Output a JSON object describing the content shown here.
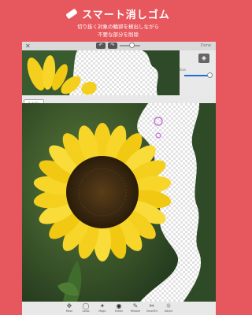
{
  "promo": {
    "title": "スマート消しゴム",
    "subtitle_line1": "切り抜く対象の輪郭を検出しながら",
    "subtitle_line2": "不要な部分を削除"
  },
  "app": {
    "top_bar": {
      "close_icon": "close-icon",
      "undo_icon": "undo-icon",
      "redo_icon": "redo-icon",
      "done_label": "Done"
    },
    "preview": {
      "slider_label": "Size",
      "layer_icon": "layers-icon"
    },
    "autofix_label": "AutoFix",
    "toolbar": {
      "tools": [
        {
          "icon": "move-icon",
          "label": "Move"
        },
        {
          "icon": "lasso-icon",
          "label": "Lasso"
        },
        {
          "icon": "magic-icon",
          "label": "Magic"
        },
        {
          "icon": "eraser-icon",
          "label": "Eraser"
        },
        {
          "icon": "restore-icon",
          "label": "Restore"
        },
        {
          "icon": "smart-eraser-icon",
          "label": "SmartErase"
        },
        {
          "icon": "adjust-icon",
          "label": "Adjust"
        }
      ]
    }
  },
  "colors": {
    "background": "#e7585e",
    "petal": "#f5cf1d",
    "center": "#3d2a12",
    "grass": "#3a5f2e",
    "brush_ring": "#c15bd6"
  }
}
